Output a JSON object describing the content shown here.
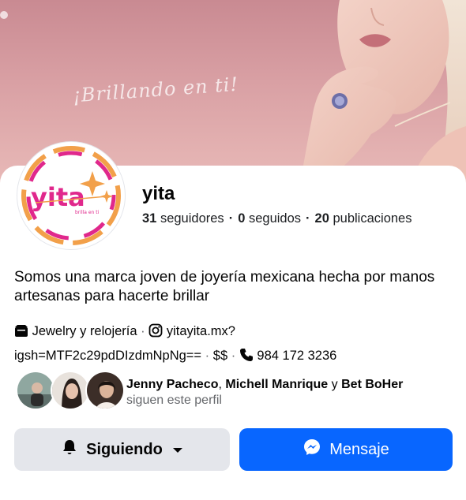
{
  "cover": {
    "tagline": "¡Brillando en ti!"
  },
  "profile": {
    "avatar_icon": "yita-logo",
    "name": "yita",
    "stats": {
      "followers_count": "31",
      "followers_label": "seguidores",
      "following_count": "0",
      "following_label": "seguidos",
      "posts_count": "20",
      "posts_label": "publicaciones"
    },
    "bio": "Somos una marca joven de joyería mexicana hecha por manos artesanas para hacerte brillar",
    "details": {
      "category_icon": "category-icon",
      "category": "Jewelry y relojería",
      "instagram_icon": "instagram-icon",
      "instagram": "yitayita.mx?",
      "instagram_cont": "igsh=MTF2c29pdDIzdmNpNg==",
      "price": "$$",
      "phone_icon": "phone-icon",
      "phone": "984 172 3236"
    }
  },
  "mutual_followers": {
    "name1": "Jenny Pacheco",
    "comma": ",",
    "name2": "Michell Manrique",
    "conj": "y",
    "name3": "Bet BoHer",
    "suffix": "siguen este perfil"
  },
  "actions": {
    "follow_label": "Siguiendo",
    "message_label": "Mensaje"
  },
  "colors": {
    "primary": "#0866ff",
    "secondary_button": "#e4e6eb",
    "text_secondary": "#65676b",
    "brand_pink": "#e0288c",
    "brand_orange": "#f2a04a"
  }
}
